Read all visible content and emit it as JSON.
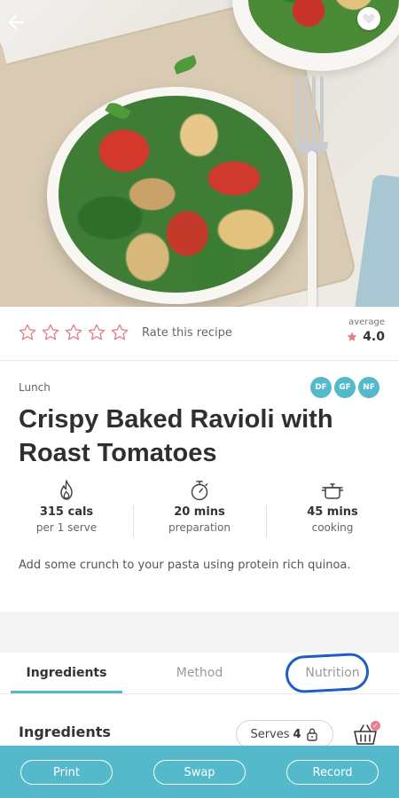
{
  "header": {
    "back_icon": "arrow-left-icon",
    "favorite_icon": "heart-icon"
  },
  "rating": {
    "stars_count": 5,
    "user_rating": 0,
    "rate_label": "Rate this recipe",
    "average_label": "average",
    "average_value": "4.0",
    "star_color": "#e77f8e"
  },
  "recipe": {
    "meal_type": "Lunch",
    "badges": [
      "DF",
      "GF",
      "NF"
    ],
    "title": "Crispy Baked Ravioli with Roast Tomatoes",
    "description": "Add some crunch to your pasta using protein rich quinoa."
  },
  "stats": [
    {
      "icon": "flame-icon",
      "value": "315 cals",
      "sub": "per 1 serve"
    },
    {
      "icon": "stopwatch-icon",
      "value": "20 mins",
      "sub": "preparation"
    },
    {
      "icon": "pot-icon",
      "value": "45 mins",
      "sub": "cooking"
    }
  ],
  "tabs": [
    {
      "label": "Ingredients",
      "active": true
    },
    {
      "label": "Method",
      "active": false
    },
    {
      "label": "Nutrition",
      "active": false
    }
  ],
  "ingredients": {
    "title": "Ingredients",
    "serves_label": "Serves",
    "serves_value": "4"
  },
  "footer": {
    "print_label": "Print",
    "swap_label": "Swap",
    "record_label": "Record"
  },
  "colors": {
    "accent": "#55b9cc",
    "star": "#e77f8e",
    "annotation": "#1f5fc4"
  }
}
